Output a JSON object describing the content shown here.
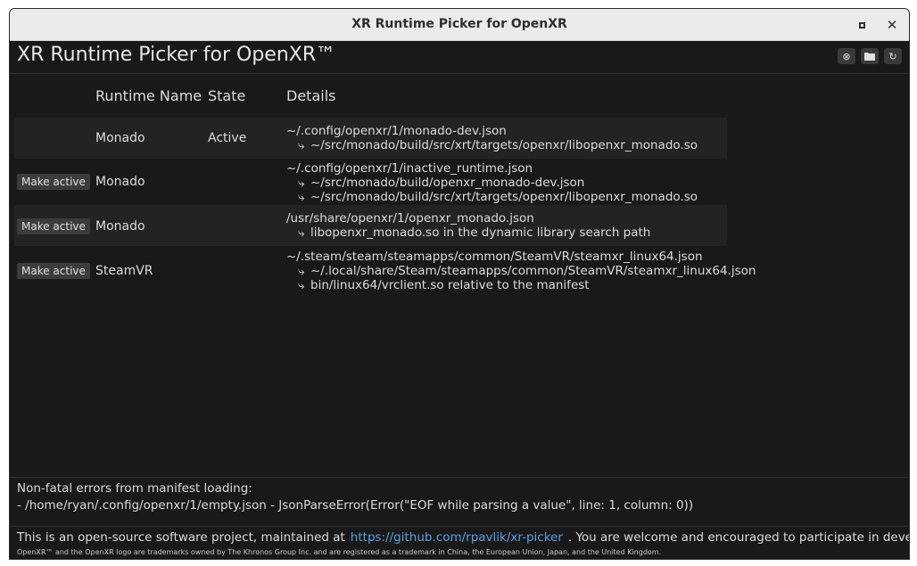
{
  "window": {
    "title": "XR Runtime Picker for OpenXR"
  },
  "header": {
    "title": "XR Runtime Picker for OpenXR™",
    "tools": [
      {
        "name": "clear-icon",
        "glyph": "⊗"
      },
      {
        "name": "folder-icon",
        "glyph": "▬"
      },
      {
        "name": "refresh-icon",
        "glyph": "↻"
      }
    ]
  },
  "columns": {
    "name": "Runtime Name",
    "state": "State",
    "details": "Details"
  },
  "runtimes": [
    {
      "button": "",
      "name": "Monado",
      "state": "Active",
      "details": [
        "~/.config/openxr/1/monado-dev.json",
        "~/src/monado/build/src/xrt/targets/openxr/libopenxr_monado.so"
      ]
    },
    {
      "button": "Make active",
      "name": "Monado",
      "state": "",
      "details": [
        "~/.config/openxr/1/inactive_runtime.json",
        "~/src/monado/build/openxr_monado-dev.json",
        "~/src/monado/build/src/xrt/targets/openxr/libopenxr_monado.so"
      ]
    },
    {
      "button": "Make active",
      "name": "Monado",
      "state": "",
      "details": [
        "/usr/share/openxr/1/openxr_monado.json",
        "libopenxr_monado.so in the dynamic library search path"
      ]
    },
    {
      "button": "Make active",
      "name": "SteamVR",
      "state": "",
      "details": [
        "~/.steam/steam/steamapps/common/SteamVR/steamxr_linux64.json",
        "~/.local/share/Steam/steamapps/common/SteamVR/steamxr_linux64.json",
        "bin/linux64/vrclient.so relative to the manifest"
      ]
    }
  ],
  "arrow_glyph": "⤷",
  "errors": {
    "heading": "Non-fatal errors from manifest loading:",
    "items": [
      "- /home/ryan/.config/openxr/1/empty.json - JsonParseError(Error(\"EOF while parsing a value\", line: 1, column: 0))"
    ]
  },
  "footer": {
    "text_before": "This is an open-source software project, maintained at",
    "link": "https://github.com/rpavlik/xr-picker",
    "text_after": ". You are welcome and encouraged to participate in development.",
    "trademark": "OpenXR™ and the OpenXR logo are trademarks owned by The Khronos Group Inc. and are registered as a trademark in China, the European Union, Japan, and the United Kingdom."
  }
}
